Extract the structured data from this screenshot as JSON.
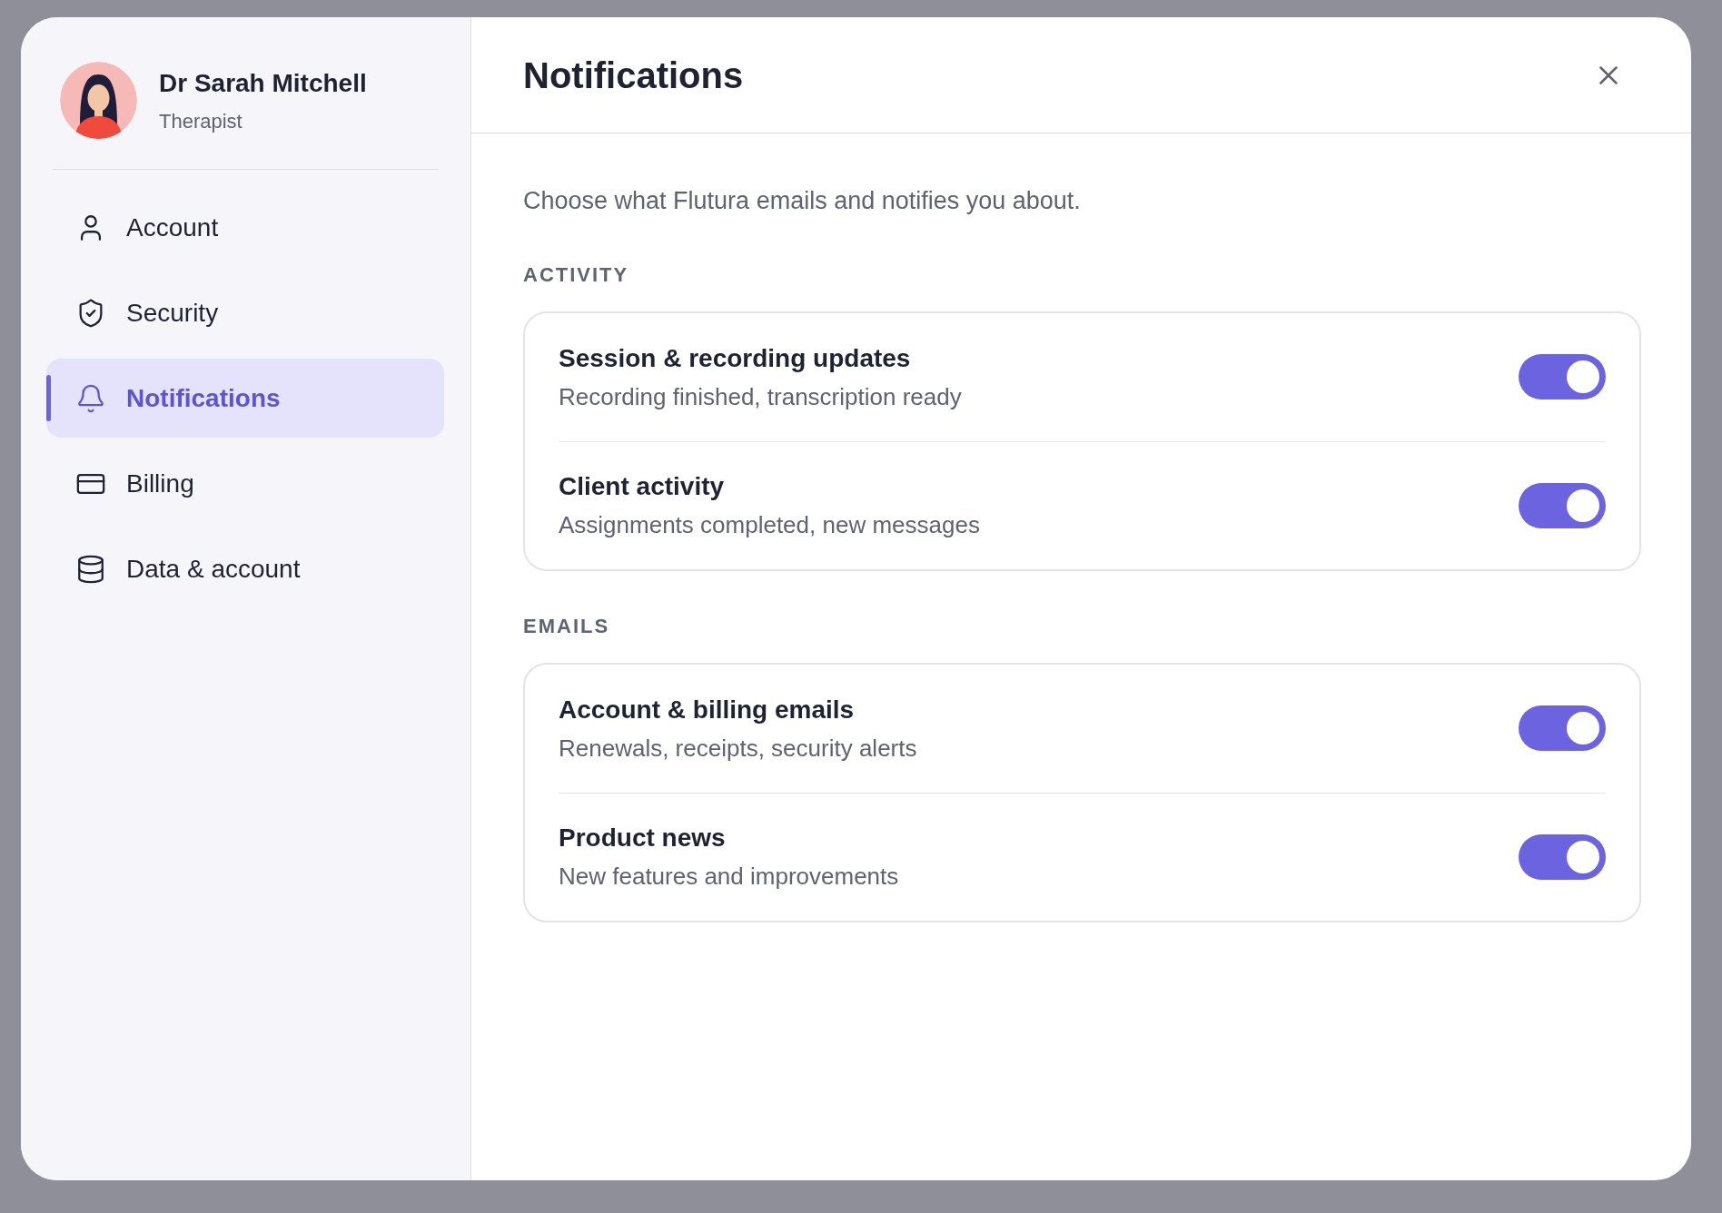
{
  "profile": {
    "name": "Dr Sarah Mitchell",
    "role": "Therapist"
  },
  "nav": [
    {
      "label": "Account",
      "kind": "user",
      "selected": false
    },
    {
      "label": "Security",
      "kind": "shield",
      "selected": false
    },
    {
      "label": "Notifications",
      "kind": "bell",
      "selected": true
    },
    {
      "label": "Billing",
      "kind": "card",
      "selected": false
    },
    {
      "label": "Data & account",
      "kind": "database",
      "selected": false
    }
  ],
  "title": "Notifications",
  "intro": "Choose what Flutura emails and notifies you about.",
  "sections": [
    {
      "heading": "ACTIVITY",
      "items": [
        {
          "title": "Session & recording updates",
          "description": "Recording finished, transcription ready",
          "on": true
        },
        {
          "title": "Client activity",
          "description": "Assignments completed, new messages",
          "on": true
        }
      ]
    },
    {
      "heading": "EMAILS",
      "items": [
        {
          "title": "Account & billing emails",
          "description": "Renewals, receipts, security alerts",
          "on": true
        },
        {
          "title": "Product news",
          "description": "New features and improvements",
          "on": true
        }
      ]
    }
  ]
}
